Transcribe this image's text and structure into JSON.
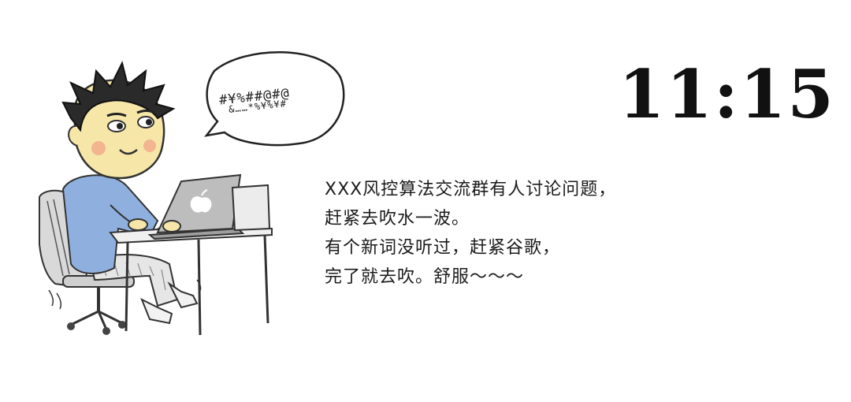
{
  "speech_bubble": {
    "line1": "#¥%##@#@",
    "line2": "&……*%¥%¥#"
  },
  "clock": {
    "time": "11:15"
  },
  "story": {
    "lines": [
      "XXX风控算法交流群有人讨论问题，",
      "赶紧去吹水一波。",
      "有个新词没听过，赶紧谷歌，",
      "完了就去吹。舒服～～～"
    ]
  },
  "icons": {
    "character": "cartoon-programmer-at-laptop",
    "laptop_logo": "apple-logo-icon"
  }
}
